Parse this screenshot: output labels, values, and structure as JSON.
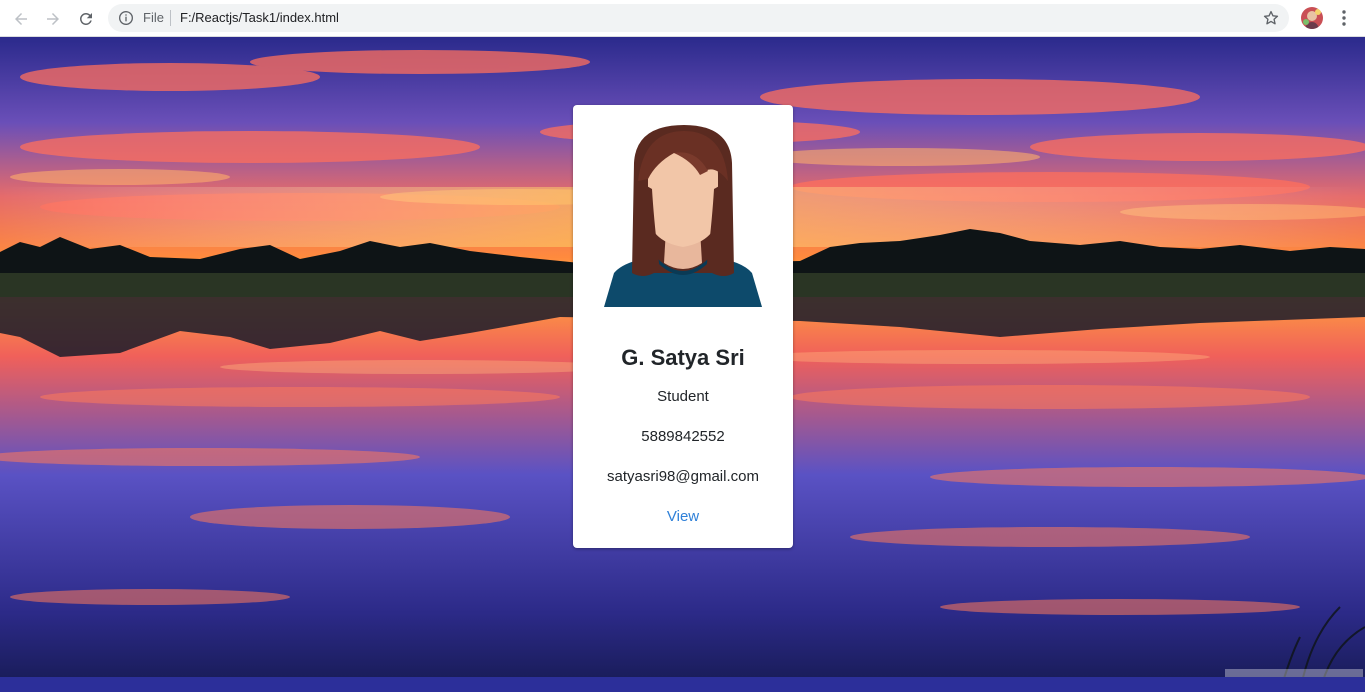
{
  "browser": {
    "scheme_label": "File",
    "url": "F:/Reactjs/Task1/index.html"
  },
  "card": {
    "name": "G. Satya Sri",
    "role": "Student",
    "phone": "5889842552",
    "email": "satyasri98@gmail.com",
    "link_label": "View"
  },
  "icons": {
    "back": "arrow-left-icon",
    "forward": "arrow-right-icon",
    "reload": "reload-icon",
    "info": "info-icon",
    "bookmark": "star-icon",
    "menu": "kebab-menu-icon"
  },
  "colors": {
    "link": "#2f80d8",
    "card_bg": "#ffffff",
    "text": "#212529"
  }
}
